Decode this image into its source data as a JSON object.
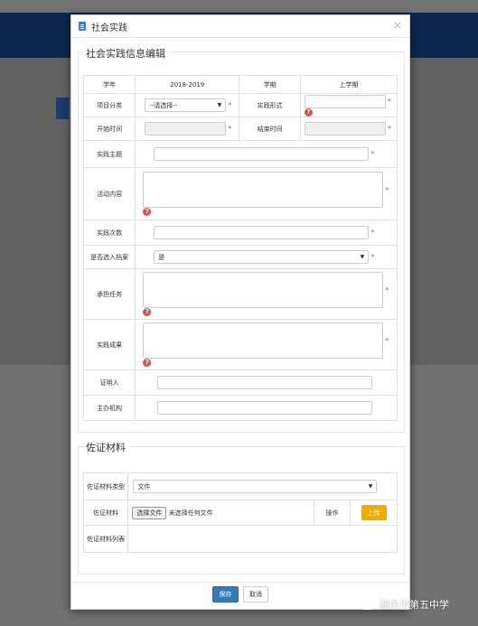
{
  "modal": {
    "title": "社会实践",
    "close": "×"
  },
  "section_info": {
    "title": "社会实践信息编辑",
    "year_label": "学年",
    "year_value": "2018-2019",
    "term_label": "学期",
    "term_value": "上学期",
    "category_label": "项目分类",
    "category_value": "--请选择--",
    "form_label": "实践形式",
    "start_label": "开始时间",
    "end_label": "结束时间",
    "theme_label": "实践主题",
    "content_label": "活动内容",
    "count_label": "实践次数",
    "archive_label": "是否选入档案",
    "archive_value": "是",
    "task_label": "承担任务",
    "result_label": "实践成果",
    "witness_label": "证明人",
    "organizer_label": "主办机构"
  },
  "section_evidence": {
    "title": "佐证材料",
    "type_label": "佐证材料类型",
    "type_value": "文件",
    "material_label": "佐证材料",
    "choose_file": "选择文件",
    "no_file": "未选择任何文件",
    "operation_label": "操作",
    "upload": "上传",
    "list_label": "佐证材料列表"
  },
  "footer": {
    "save": "保存",
    "cancel": "取消"
  },
  "watermark": {
    "text": "韶关市第五中学"
  },
  "colors": {
    "primary": "#337ab7",
    "upload": "#f0ad00",
    "required": "#d9534f"
  }
}
